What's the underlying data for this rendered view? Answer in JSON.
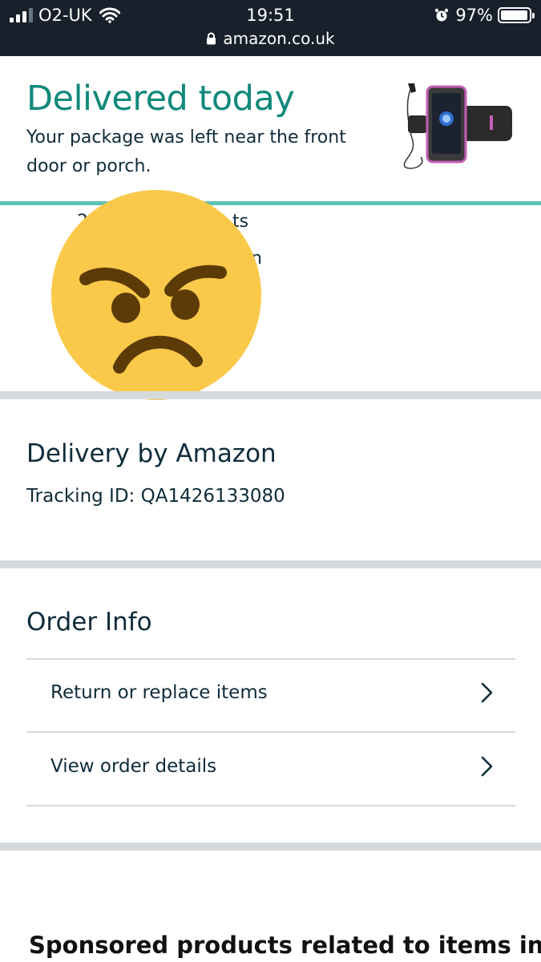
{
  "status_bar": {
    "carrier": "O2-UK",
    "time": "19:51",
    "battery": "97%",
    "url": "amazon.co.uk",
    "icons": [
      "signal-icon",
      "wifi-icon",
      "alarm-icon",
      "battery-icon",
      "lock-icon"
    ]
  },
  "delivery": {
    "title": "Delivered today",
    "message": "Your package was left near the front door or porch.",
    "obscured_fragments": [
      "2",
      "ts",
      "n"
    ]
  },
  "shipment": {
    "carrier_title": "Delivery by Amazon",
    "tracking": "Tracking ID: QA1426133080"
  },
  "order_info": {
    "title": "Order Info",
    "items": [
      {
        "label": "Return or replace items"
      },
      {
        "label": "View order details"
      }
    ]
  },
  "sponsored": {
    "heading": "Sponsored products related to items in"
  },
  "colors": {
    "status_bar": "#17202b",
    "title_teal": "#11897a",
    "rule_teal": "#5dc2b8",
    "text": "#0f2c3a",
    "section_gap": "#d7dadd",
    "emoji_face": "#fbc94a",
    "emoji_features": "#5c3b07"
  }
}
